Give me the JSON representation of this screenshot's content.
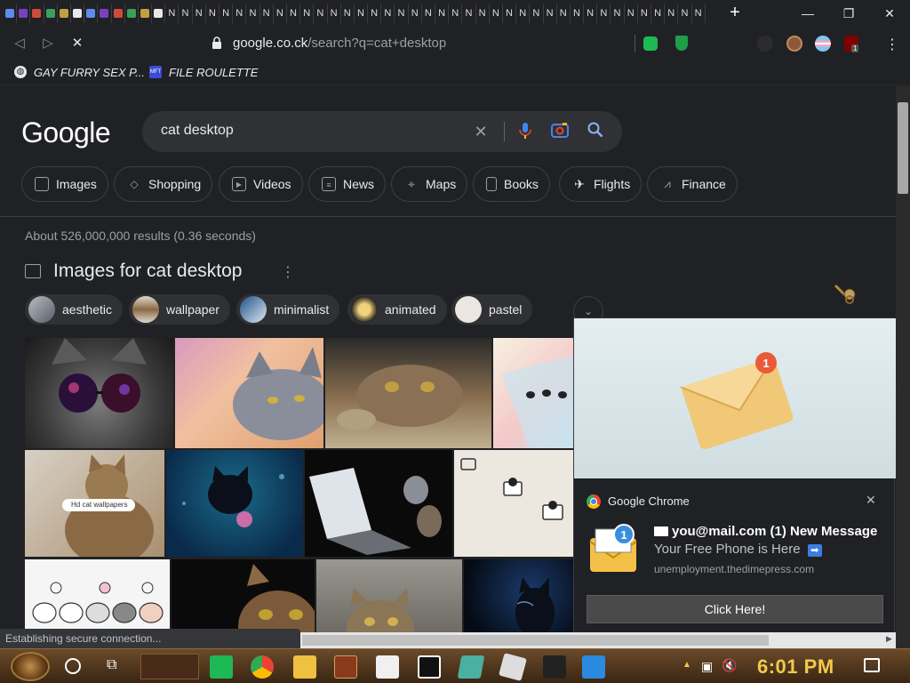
{
  "browser": {
    "tab_favicons_n": "N",
    "new_tab": "+",
    "window": {
      "minimize": "—",
      "restore": "❐",
      "close": "✕"
    },
    "url_host": "google.co.ck",
    "url_path": "/search?q=cat+desktop",
    "bookmarks": [
      {
        "label": "GAY FURRY SEX P...",
        "icon": "globe-icon"
      },
      {
        "label": "FILE ROULETTE",
        "icon": "MFT"
      }
    ],
    "extension_badge": "1"
  },
  "google": {
    "logo": "Google",
    "query": "cat desktop",
    "filters": [
      "Images",
      "Shopping",
      "Videos",
      "News",
      "Maps",
      "Books",
      "Flights",
      "Finance"
    ],
    "stats": "About 526,000,000 results (0.36 seconds)",
    "images_heading": "Images for cat desktop",
    "refinements": [
      "aesthetic",
      "wallpaper",
      "minimalist",
      "animated",
      "pastel"
    ],
    "tile_overlay_text": "Hd cat wallpapers"
  },
  "notification": {
    "app": "Google Chrome",
    "title": "you@mail.com (1) New Message",
    "body": "Your Free Phone is Here",
    "source": "unemployment.thedimepress.com",
    "button": "Click Here!",
    "badge_count": "1"
  },
  "status": {
    "text": "Establishing secure connection..."
  },
  "taskbar": {
    "clock": "6:01 PM"
  },
  "colors": {
    "background": "#202124",
    "surface": "#303134",
    "text": "#e8eaed",
    "muted": "#9aa0a6",
    "accent_blue": "#8ab4f8",
    "clock": "#f2c94c"
  }
}
